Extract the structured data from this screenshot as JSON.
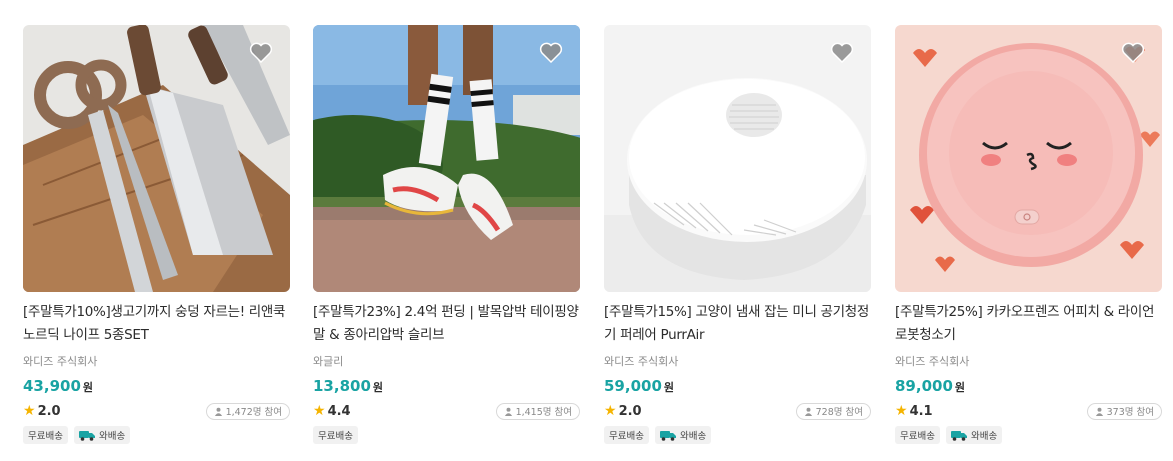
{
  "products": [
    {
      "title": "[주말특가10%]생고기까지 숭덩 자르는! 리앤쿡 노르딕 나이프 5종SET",
      "seller": "와디즈 주식회사",
      "price": "43,900",
      "currency": "원",
      "rating": "2.0",
      "participants": "1,472명 참여",
      "tags": [
        "무료배송",
        "와배송"
      ],
      "image_icon": "knife-set-image"
    },
    {
      "title": "[주말특가23%] 2.4억 펀딩 | 발목압박 테이핑양말 & 종아리압박 슬리브",
      "seller": "와글리",
      "price": "13,800",
      "currency": "원",
      "rating": "4.4",
      "participants": "1,415명 참여",
      "tags": [
        "무료배송"
      ],
      "image_icon": "running-socks-image"
    },
    {
      "title": "[주말특가15%] 고양이 냄새 잡는 미니 공기청정기 퍼레어 PurrAir",
      "seller": "와디즈 주식회사",
      "price": "59,000",
      "currency": "원",
      "rating": "2.0",
      "participants": "728명 참여",
      "tags": [
        "무료배송",
        "와배송"
      ],
      "image_icon": "air-purifier-image"
    },
    {
      "title": "[주말특가25%] 카카오프렌즈 어피치 & 라이언 로봇청소기",
      "seller": "와디즈 주식회사",
      "price": "89,000",
      "currency": "원",
      "rating": "4.1",
      "participants": "373명 참여",
      "tags": [
        "무료배송",
        "와배송"
      ],
      "image_icon": "robot-vacuum-image"
    }
  ],
  "colors": {
    "price": "#19a3a3",
    "star": "#f5b400",
    "truck": "#19a3a3"
  }
}
